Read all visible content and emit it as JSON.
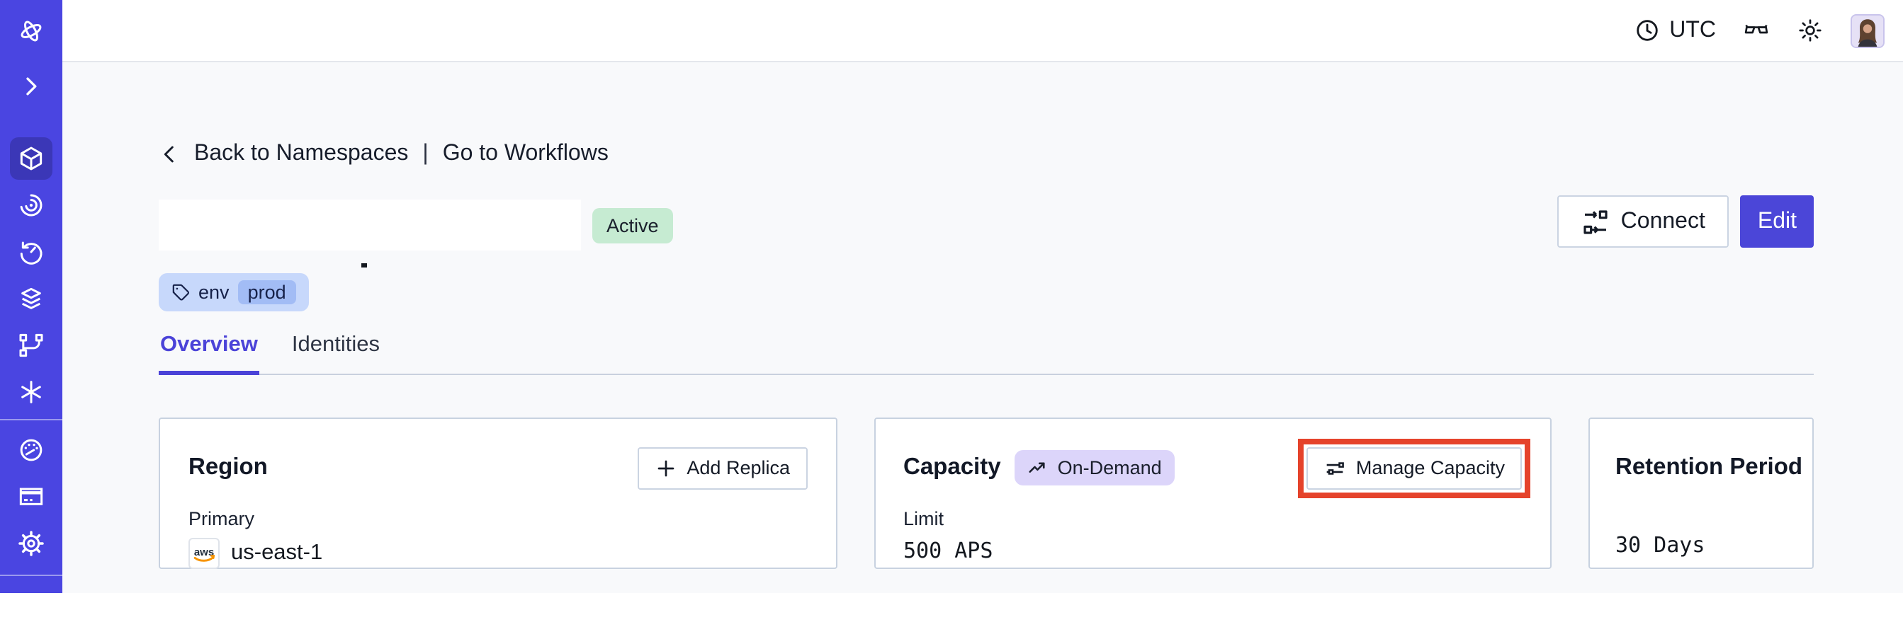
{
  "topbar": {
    "timezone": "UTC"
  },
  "breadcrumb": {
    "back_label": "Back to Namespaces",
    "separator": "|",
    "workflows_label": "Go to Workflows"
  },
  "namespace": {
    "status_badge": "Active",
    "tag": {
      "key": "env",
      "value": "prod"
    }
  },
  "header_actions": {
    "connect_label": "Connect",
    "edit_label": "Edit"
  },
  "tabs": {
    "overview": "Overview",
    "identities": "Identities"
  },
  "cards": {
    "region": {
      "title": "Region",
      "add_replica_label": "Add Replica",
      "primary_label": "Primary",
      "provider": "aws",
      "region_value": "us-east-1"
    },
    "capacity": {
      "title": "Capacity",
      "plan_badge": "On-Demand",
      "manage_label": "Manage Capacity",
      "limit_label": "Limit",
      "limit_value": "500 APS"
    },
    "retention": {
      "title": "Retention Period",
      "value": "30 Days"
    }
  },
  "icons": {
    "sidebar": [
      "temporal-logo-icon",
      "expand-chevron-icon",
      "namespaces-cube-icon",
      "workflows-spiral-icon",
      "schedules-history-icon",
      "deployments-layers-icon",
      "batch-branch-icon",
      "nexus-asterisk-icon",
      "usage-gauge-icon",
      "billing-card-icon",
      "settings-gear-icon",
      "account-globe-icon"
    ],
    "topbar": [
      "clock-icon",
      "glasses-icon",
      "sun-icon",
      "avatar"
    ]
  },
  "colors": {
    "sidebar": "#4A45E1",
    "accent": "#4B46D8",
    "active_badge_bg": "#C6EBD2",
    "ondemand_badge_bg": "#DCD5FA",
    "tag_bg": "#C7D8FB",
    "tag_value_bg": "#A2BCF5",
    "highlight_ring": "#E5432B",
    "aws_orange": "#F79400"
  }
}
